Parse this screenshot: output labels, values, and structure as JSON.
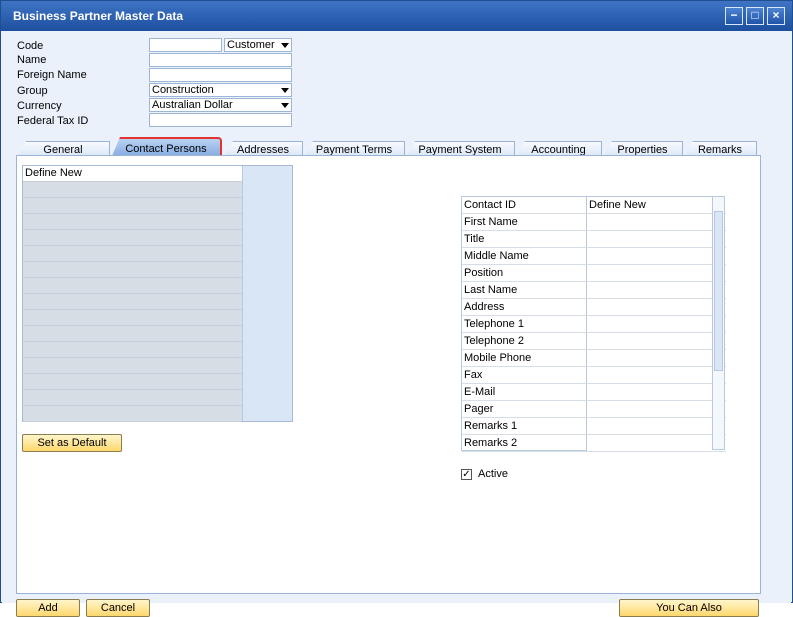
{
  "window": {
    "title": "Business Partner Master Data"
  },
  "header": {
    "labels": [
      "Code",
      "Name",
      "Foreign Name",
      "Group",
      "Currency",
      "Federal Tax ID"
    ],
    "code_type": "Customer",
    "group": "Construction",
    "currency": "Australian Dollar"
  },
  "tabs": [
    "General",
    "Contact Persons",
    "Addresses",
    "Payment Terms",
    "Payment System",
    "Accounting",
    "Properties",
    "Remarks"
  ],
  "left_list": {
    "first_row": "Define New"
  },
  "details": {
    "rows": [
      {
        "label": "Contact ID",
        "value": "Define New"
      },
      {
        "label": "First Name",
        "value": ""
      },
      {
        "label": "Title",
        "value": ""
      },
      {
        "label": "Middle Name",
        "value": ""
      },
      {
        "label": "Position",
        "value": ""
      },
      {
        "label": "Last Name",
        "value": ""
      },
      {
        "label": "Address",
        "value": ""
      },
      {
        "label": "Telephone 1",
        "value": ""
      },
      {
        "label": "Telephone 2",
        "value": ""
      },
      {
        "label": "Mobile Phone",
        "value": ""
      },
      {
        "label": "Fax",
        "value": ""
      },
      {
        "label": "E-Mail",
        "value": ""
      },
      {
        "label": "Pager",
        "value": ""
      },
      {
        "label": "Remarks 1",
        "value": ""
      },
      {
        "label": "Remarks 2",
        "value": ""
      }
    ]
  },
  "buttons": {
    "set_default": "Set as Default",
    "add": "Add",
    "cancel": "Cancel",
    "you_can_also": "You Can Also"
  },
  "active_label": "Active",
  "icons": {
    "minimize": "−",
    "maximize": "□",
    "close": "×",
    "check": "✓"
  }
}
